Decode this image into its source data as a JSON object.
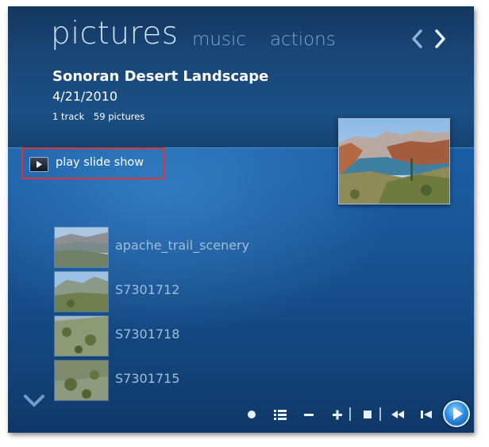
{
  "nav": {
    "pictures": "pictures",
    "music": "music",
    "actions": "actions"
  },
  "album": {
    "title": "Sonoran Desert Landscape",
    "date": "4/21/2010",
    "tracks": "1 track",
    "pictures_count": "59 pictures"
  },
  "slideshow": {
    "label": "play slide show"
  },
  "items": [
    {
      "label": "apache_trail_scenery"
    },
    {
      "label": "S7301712"
    },
    {
      "label": "S7301718"
    },
    {
      "label": "S7301715"
    }
  ],
  "colors": {
    "accent": "#2f8fe0",
    "highlight_border": "#e03434",
    "background": "#1c5ea4"
  }
}
